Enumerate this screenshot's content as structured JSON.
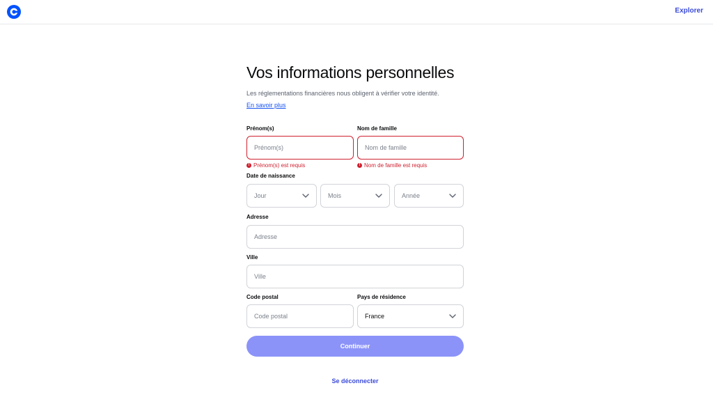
{
  "header": {
    "explore_label": "Explorer"
  },
  "form": {
    "title": "Vos informations personnelles",
    "subtitle": "Les réglementations financières nous obligent à vérifier votre identité.",
    "learn_more": "En savoir plus",
    "first_name": {
      "label": "Prénom(s)",
      "placeholder": "Prénom(s)",
      "error": "Prénom(s) est requis"
    },
    "last_name": {
      "label": "Nom de famille",
      "placeholder": "Nom de famille",
      "error": "Nom de famille est requis"
    },
    "birth_date": {
      "label": "Date de naissance",
      "day": "Jour",
      "month": "Mois",
      "year": "Année"
    },
    "address": {
      "label": "Adresse",
      "placeholder": "Adresse"
    },
    "city": {
      "label": "Ville",
      "placeholder": "Ville"
    },
    "postal_code": {
      "label": "Code postal",
      "placeholder": "Code postal"
    },
    "country": {
      "label": "Pays de résidence",
      "value": "France"
    },
    "continue_label": "Continuer",
    "logout_label": "Se déconnecter"
  },
  "colors": {
    "brand": "#0052ff",
    "error": "#cf202f",
    "button_disabled": "#8b93f8",
    "link": "#3b4bd8"
  },
  "icons": {
    "logo": "coinbase-logo-icon",
    "error": "error-circle-icon",
    "dropdown": "chevron-down-icon"
  }
}
